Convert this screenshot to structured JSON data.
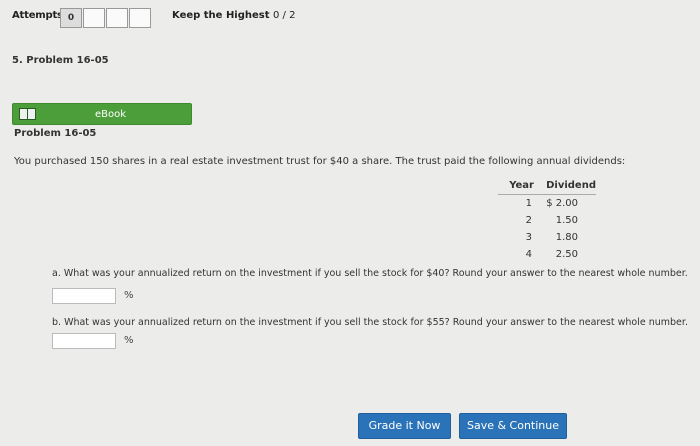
{
  "attempts": {
    "label": "Attempts",
    "count": "0",
    "keep_label": "Keep the Highest",
    "score": "0 / 2"
  },
  "problem_heading": "5. Problem 16-05",
  "ebook": {
    "label": "eBook",
    "icon": "book-icon"
  },
  "problem": {
    "title": "Problem 16-05",
    "text": "You purchased 150 shares in a real estate investment trust for $40 a share. The trust paid the following annual dividends:",
    "table": {
      "headers": [
        "Year",
        "Dividend"
      ],
      "rows": [
        [
          "1",
          "$ 2.00"
        ],
        [
          "2",
          "1.50"
        ],
        [
          "3",
          "1.80"
        ],
        [
          "4",
          "2.50"
        ]
      ]
    }
  },
  "questions": [
    {
      "text": "a. What was your annualized return on the investment if you sell the stock for $40? Round your answer to the nearest whole number.",
      "value": "",
      "unit": "%"
    },
    {
      "text": "b. What was your annualized return on the investment if you sell the stock for $55? Round your answer to the nearest whole number.",
      "value": "",
      "unit": "%"
    }
  ],
  "buttons": {
    "grade": "Grade it Now",
    "save": "Save & Continue"
  },
  "colors": {
    "ebook_green": "#4c9e3b",
    "button_blue": "#2a73b8"
  }
}
